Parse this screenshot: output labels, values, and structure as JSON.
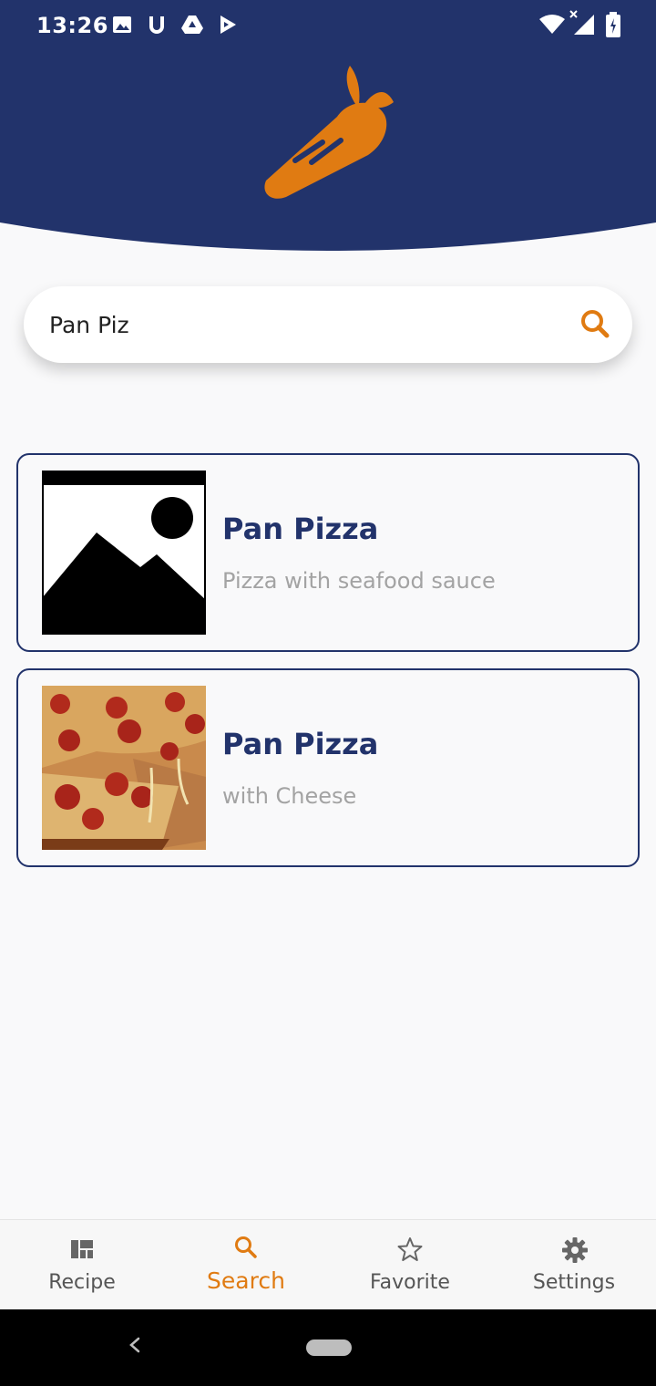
{
  "status_bar": {
    "time": "13:26",
    "icons": [
      "image-icon",
      "u-icon",
      "drive-icon",
      "play-store-icon",
      "wifi-icon",
      "signal-icon",
      "battery-icon"
    ]
  },
  "colors": {
    "header_bg": "#22336b",
    "accent": "#e07b12",
    "title": "#22336b",
    "subtitle": "#a3a3a3"
  },
  "search": {
    "value": "Pan Piz",
    "icon": "search-icon"
  },
  "results": [
    {
      "title": "Pan Pizza",
      "subtitle": "Pizza with seafood sauce",
      "image": "placeholder-image"
    },
    {
      "title": "Pan Pizza",
      "subtitle": "with Cheese",
      "image": "pizza-photo"
    }
  ],
  "bottom_nav": {
    "items": [
      {
        "label": "Recipe",
        "icon": "recipe-icon"
      },
      {
        "label": "Search",
        "icon": "search-icon",
        "active": true
      },
      {
        "label": "Favorite",
        "icon": "star-icon"
      },
      {
        "label": "Settings",
        "icon": "gear-icon"
      }
    ]
  }
}
